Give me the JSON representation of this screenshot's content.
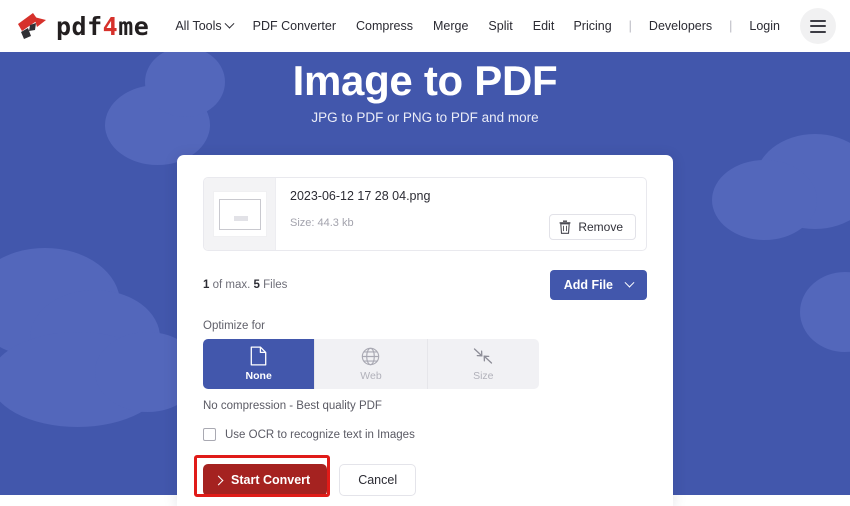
{
  "header": {
    "logo": {
      "icon": "pdf4me-logo-icon",
      "text_a": "pdf",
      "text_b": "4",
      "text_c": "me"
    },
    "nav_main": [
      {
        "label": "All Tools",
        "has_caret": true
      },
      {
        "label": "PDF Converter",
        "has_caret": false
      },
      {
        "label": "Compress",
        "has_caret": false
      },
      {
        "label": "Merge",
        "has_caret": false
      },
      {
        "label": "Split",
        "has_caret": false
      },
      {
        "label": "Edit",
        "has_caret": false
      }
    ],
    "nav_right": [
      {
        "label": "Pricing"
      },
      {
        "label": "|"
      },
      {
        "label": "Developers"
      },
      {
        "label": "|"
      },
      {
        "label": "Login"
      }
    ],
    "menu_icon": "hamburger-menu-icon"
  },
  "hero": {
    "title": "Image to PDF",
    "subtitle": "JPG to PDF or PNG to PDF and more",
    "background_color": "#4257ac",
    "cloud_color": "#5367bb"
  },
  "card": {
    "file": {
      "name": "2023-06-12 17 28 04.png",
      "size": "Size: 44.3 kb",
      "thumbnail_icon": "file-thumbnail-icon",
      "remove_label": "Remove",
      "remove_icon": "trash-icon"
    },
    "count": {
      "current": "1",
      "mid": " of max. ",
      "max": "5",
      "suffix": " Files"
    },
    "add_file_label": "Add File",
    "optimize": {
      "label": "Optimize for",
      "options": [
        {
          "label": "None",
          "icon": "document-icon",
          "selected": true
        },
        {
          "label": "Web",
          "icon": "globe-icon",
          "selected": false
        },
        {
          "label": "Size",
          "icon": "compress-arrows-icon",
          "selected": false
        }
      ],
      "hint": "No compression - Best quality PDF"
    },
    "ocr": {
      "label": "Use OCR to recognize text in Images",
      "checked": false
    },
    "actions": {
      "start_label": "Start Convert",
      "cancel_label": "Cancel",
      "start_color": "#a52220",
      "highlight_color": "#e01b18"
    }
  }
}
